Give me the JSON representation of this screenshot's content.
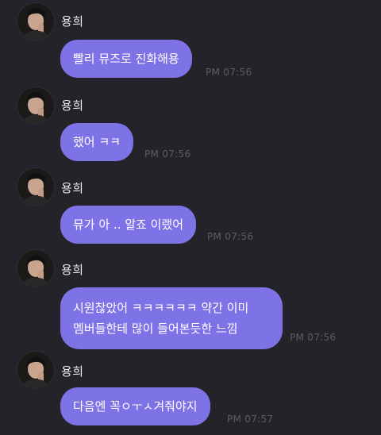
{
  "messages": [
    {
      "sender": "용희",
      "text": "빨리 뮤즈로 진화해용",
      "time": "PM 07:56"
    },
    {
      "sender": "용희",
      "text": "했어 ㅋㅋ",
      "time": "PM 07:56"
    },
    {
      "sender": "용희",
      "text": "뮤가 아 .. 알죠 이랬어",
      "time": "PM 07:56"
    },
    {
      "sender": "용희",
      "text_line1": "시원찮았어 ㅋㅋㅋㅋㅋㅋ 약간 이미",
      "text_line2": "멤버들한테 많이 들어본듯한 느낌",
      "time": "PM 07:56"
    },
    {
      "sender": "용희",
      "text": "다음엔 꼭ㅇㅜㅅ겨줘야지",
      "time": "PM 07:57"
    }
  ],
  "colors": {
    "background": "#232329",
    "bubble": "#7d73e6",
    "bubble_text": "#ffffff",
    "sender_text": "#e9e9ee",
    "timestamp": "#5c5c66"
  },
  "icons": {
    "avatar": "profile-photo"
  }
}
